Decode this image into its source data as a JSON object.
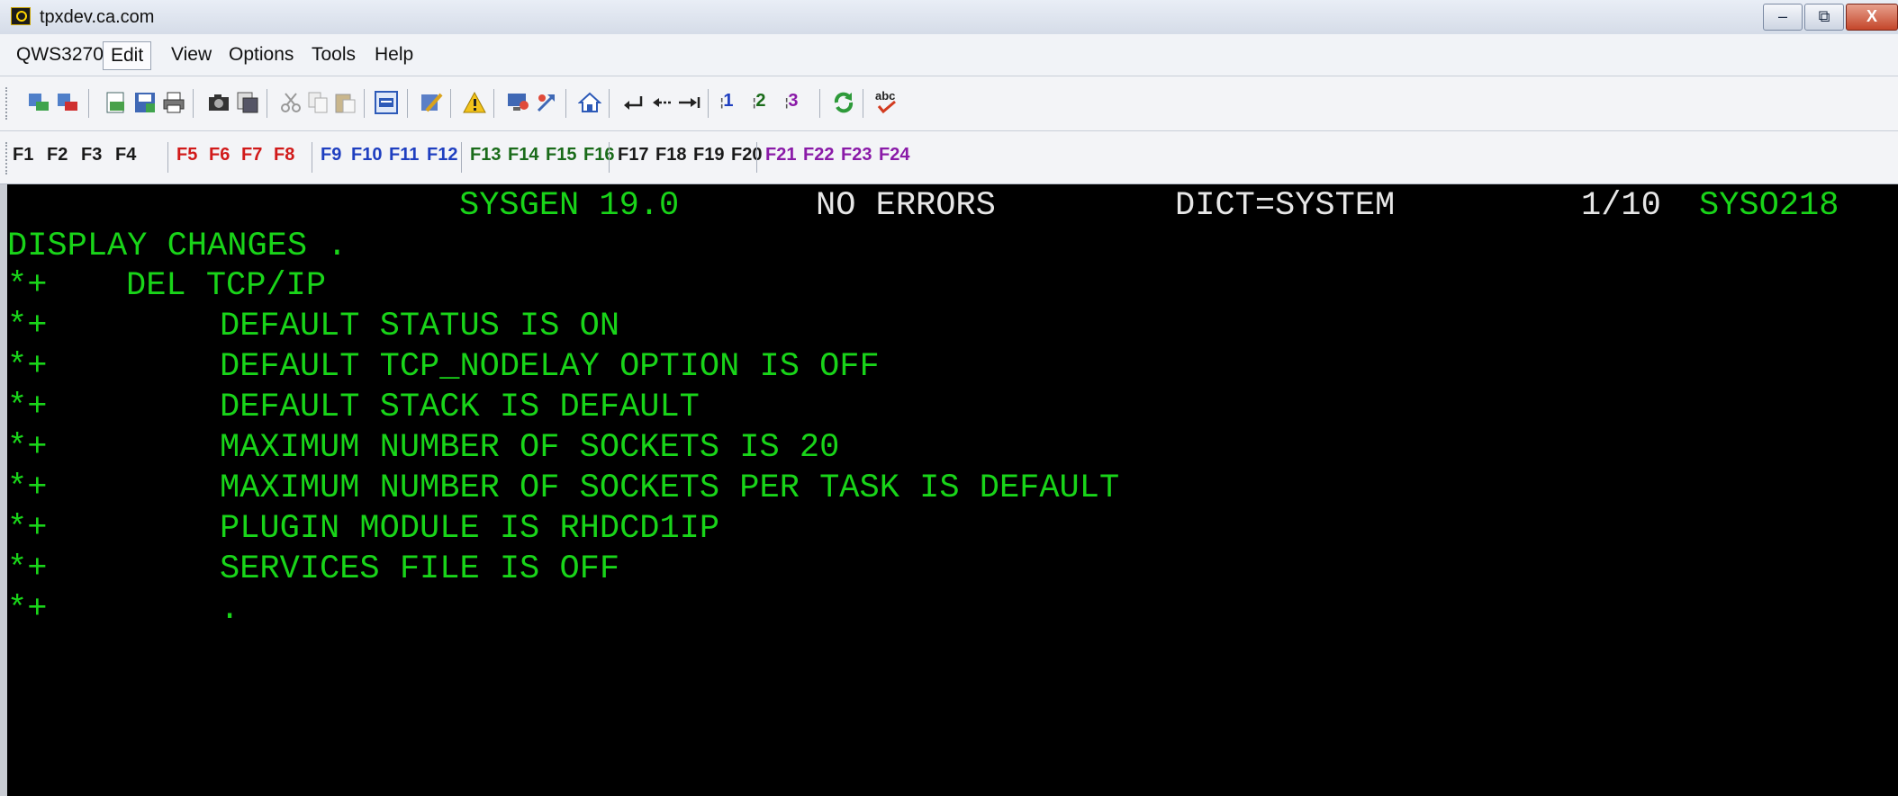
{
  "window": {
    "title": "tpxdev.ca.com",
    "buttons": {
      "minimize": "–",
      "maximize": "⧉",
      "close": "X"
    }
  },
  "menu": {
    "items": [
      "QWS3270",
      "Edit",
      "View",
      "Options",
      "Tools",
      "Help"
    ]
  },
  "toolbar": {
    "icons": [
      "connect-icon",
      "disconnect-icon",
      "open-session-icon",
      "save-session-icon",
      "print-icon",
      "camera-icon",
      "copy-screen-icon",
      "cut-icon",
      "copy-icon",
      "paste-icon",
      "keyboard-icon",
      "macro-icon",
      "warning-icon",
      "monitor-icon",
      "transfer-icon",
      "home-icon",
      "enter-icon",
      "field-back-icon",
      "field-tab-icon",
      "pa1-icon",
      "pa2-icon",
      "pa3-icon",
      "refresh-icon",
      "spellcheck-icon"
    ],
    "labels": {
      "pa1": "1",
      "pa2": "2",
      "pa3": "3",
      "spell": "abc"
    }
  },
  "fkeys": {
    "group1": [
      "F1",
      "F2",
      "F3",
      "F4"
    ],
    "group2": [
      "F5",
      "F6",
      "F7",
      "F8"
    ],
    "group3": [
      "F9",
      "F10",
      "F11",
      "F12"
    ],
    "group4": [
      "F13",
      "F14",
      "F15",
      "F16"
    ],
    "group5": [
      "F17",
      "F18",
      "F19",
      "F20"
    ],
    "group6": [
      "F21",
      "F22",
      "F23",
      "F24"
    ],
    "colors": {
      "group1": "#1a1a1a",
      "group2": "#d11a1a",
      "group3": "#1f3fc0",
      "group4": "#1a6b1a",
      "group5": "#1a1a1a",
      "group6": "#8a1aa8"
    }
  },
  "terminal": {
    "header": {
      "product": "SYSGEN 19.0",
      "status": "NO ERRORS",
      "dict": "DICT=SYSTEM",
      "page": "1/10",
      "msgid": "SYSO218"
    },
    "command": "DISPLAY CHANGES .",
    "lines": [
      {
        "prefix": "*+",
        "text": "DEL TCP/IP"
      },
      {
        "prefix": "*+",
        "text": "DEFAULT STATUS IS ON"
      },
      {
        "prefix": "*+",
        "text": "DEFAULT TCP_NODELAY OPTION IS OFF"
      },
      {
        "prefix": "*+",
        "text": "DEFAULT STACK IS DEFAULT"
      },
      {
        "prefix": "*+",
        "text": "MAXIMUM NUMBER OF SOCKETS IS 20"
      },
      {
        "prefix": "*+",
        "text": "MAXIMUM NUMBER OF SOCKETS PER TASK IS DEFAULT"
      },
      {
        "prefix": "*+",
        "text": "PLUGIN MODULE IS RHDCD1IP"
      },
      {
        "prefix": "*+",
        "text": "SERVICES FILE IS OFF"
      },
      {
        "prefix": "*+",
        "text": "."
      }
    ],
    "colors": {
      "text": "#19d419",
      "highlight": "#e6e6e6",
      "background": "#000000"
    }
  }
}
